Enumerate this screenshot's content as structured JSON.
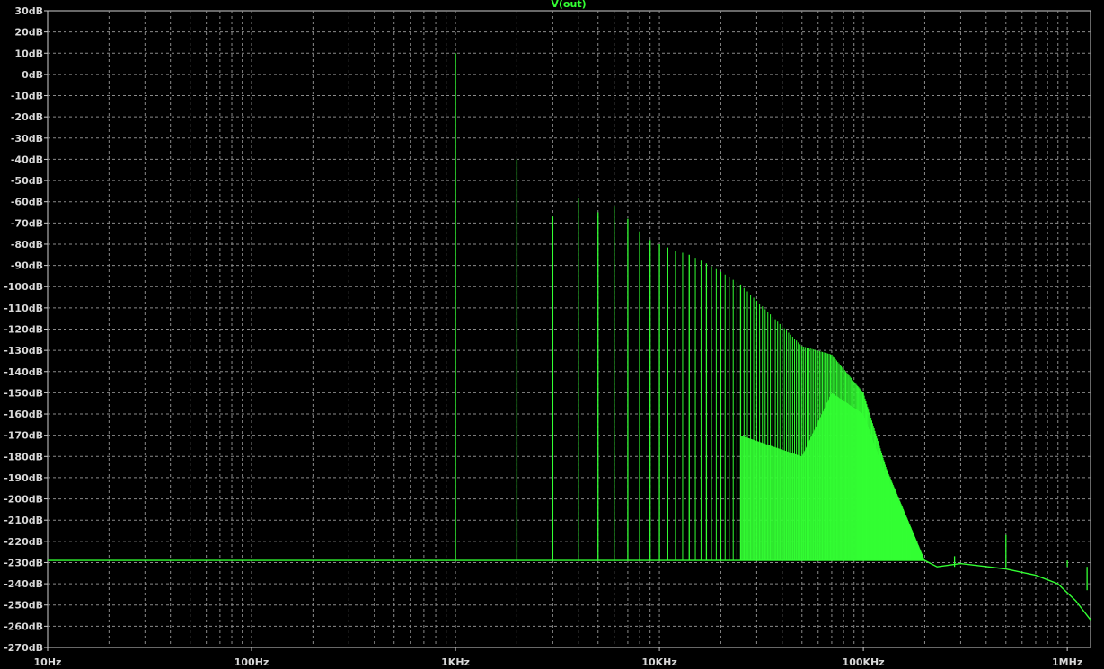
{
  "colors": {
    "background": "#000000",
    "trace": "#33ff33",
    "grid": "#8a8a8a",
    "axis": "#cfcfcf",
    "text": "#d8d8d8"
  },
  "chart_data": {
    "type": "line",
    "title": "V(out)",
    "x_scale": "log",
    "xlim": [
      10,
      1300000
    ],
    "ylim": [
      -270,
      30
    ],
    "grid": true,
    "x_ticks": [
      {
        "value": 10,
        "label": "10Hz"
      },
      {
        "value": 100,
        "label": "100Hz"
      },
      {
        "value": 1000,
        "label": "1KHz"
      },
      {
        "value": 10000,
        "label": "10KHz"
      },
      {
        "value": 100000,
        "label": "100KHz"
      },
      {
        "value": 1000000,
        "label": "1MHz"
      }
    ],
    "y_ticks": [
      {
        "value": 30,
        "label": "30dB"
      },
      {
        "value": 20,
        "label": "20dB"
      },
      {
        "value": 10,
        "label": "10dB"
      },
      {
        "value": 0,
        "label": "0dB"
      },
      {
        "value": -10,
        "label": "-10dB"
      },
      {
        "value": -20,
        "label": "-20dB"
      },
      {
        "value": -30,
        "label": "-30dB"
      },
      {
        "value": -40,
        "label": "-40dB"
      },
      {
        "value": -50,
        "label": "-50dB"
      },
      {
        "value": -60,
        "label": "-60dB"
      },
      {
        "value": -70,
        "label": "-70dB"
      },
      {
        "value": -80,
        "label": "-80dB"
      },
      {
        "value": -90,
        "label": "-90dB"
      },
      {
        "value": -100,
        "label": "-100dB"
      },
      {
        "value": -110,
        "label": "-110dB"
      },
      {
        "value": -120,
        "label": "-120dB"
      },
      {
        "value": -130,
        "label": "-130dB"
      },
      {
        "value": -140,
        "label": "-140dB"
      },
      {
        "value": -150,
        "label": "-150dB"
      },
      {
        "value": -160,
        "label": "-160dB"
      },
      {
        "value": -170,
        "label": "-170dB"
      },
      {
        "value": -180,
        "label": "-180dB"
      },
      {
        "value": -190,
        "label": "-190dB"
      },
      {
        "value": -200,
        "label": "-200dB"
      },
      {
        "value": -210,
        "label": "-210dB"
      },
      {
        "value": -220,
        "label": "-220dB"
      },
      {
        "value": -230,
        "label": "-230dB"
      },
      {
        "value": -240,
        "label": "-240dB"
      },
      {
        "value": -250,
        "label": "-250dB"
      },
      {
        "value": -260,
        "label": "-260dB"
      },
      {
        "value": -270,
        "label": "-270dB"
      }
    ],
    "noise_floor": [
      {
        "x": 10,
        "y": -229
      },
      {
        "x": 200000,
        "y": -229
      },
      {
        "x": 230000,
        "y": -232
      },
      {
        "x": 300000,
        "y": -230.5
      },
      {
        "x": 500000,
        "y": -233
      },
      {
        "x": 700000,
        "y": -236
      },
      {
        "x": 900000,
        "y": -240
      },
      {
        "x": 1100000,
        "y": -248
      },
      {
        "x": 1300000,
        "y": -257
      }
    ],
    "harmonics": [
      {
        "x": 1000,
        "peak": 10,
        "low": -50
      },
      {
        "x": 2000,
        "peak": -40,
        "low": -133
      },
      {
        "x": 3000,
        "peak": -67,
        "low": -148
      },
      {
        "x": 4000,
        "peak": -58
      },
      {
        "x": 5000,
        "peak": -65
      },
      {
        "x": 6000,
        "peak": -62
      },
      {
        "x": 7000,
        "peak": -68
      },
      {
        "x": 8000,
        "peak": -74
      },
      {
        "x": 9000,
        "peak": -78
      },
      {
        "x": 10000,
        "peak": -80
      },
      {
        "x": 12000,
        "peak": -83,
        "low": -160
      },
      {
        "x": 14000,
        "peak": -85,
        "low": -162
      },
      {
        "x": 17000,
        "peak": -89,
        "low": -163
      },
      {
        "x": 20000,
        "peak": -93,
        "low": -166
      },
      {
        "x": 25000,
        "peak": -99,
        "low": -170
      },
      {
        "x": 50000,
        "peak": -128,
        "low": -180
      },
      {
        "x": 70000,
        "peak": -132,
        "low": -150
      },
      {
        "x": 100000,
        "peak": -150,
        "low": -160
      },
      {
        "x": 130000,
        "peak": -186,
        "low": -190
      },
      {
        "x": 200000,
        "peak": -229
      }
    ],
    "spurs": [
      {
        "x": 280000,
        "peak": -227
      },
      {
        "x": 500000,
        "peak": -217
      },
      {
        "x": 1000000,
        "peak": -229
      },
      {
        "x": 1250000,
        "peak": -243
      }
    ]
  }
}
